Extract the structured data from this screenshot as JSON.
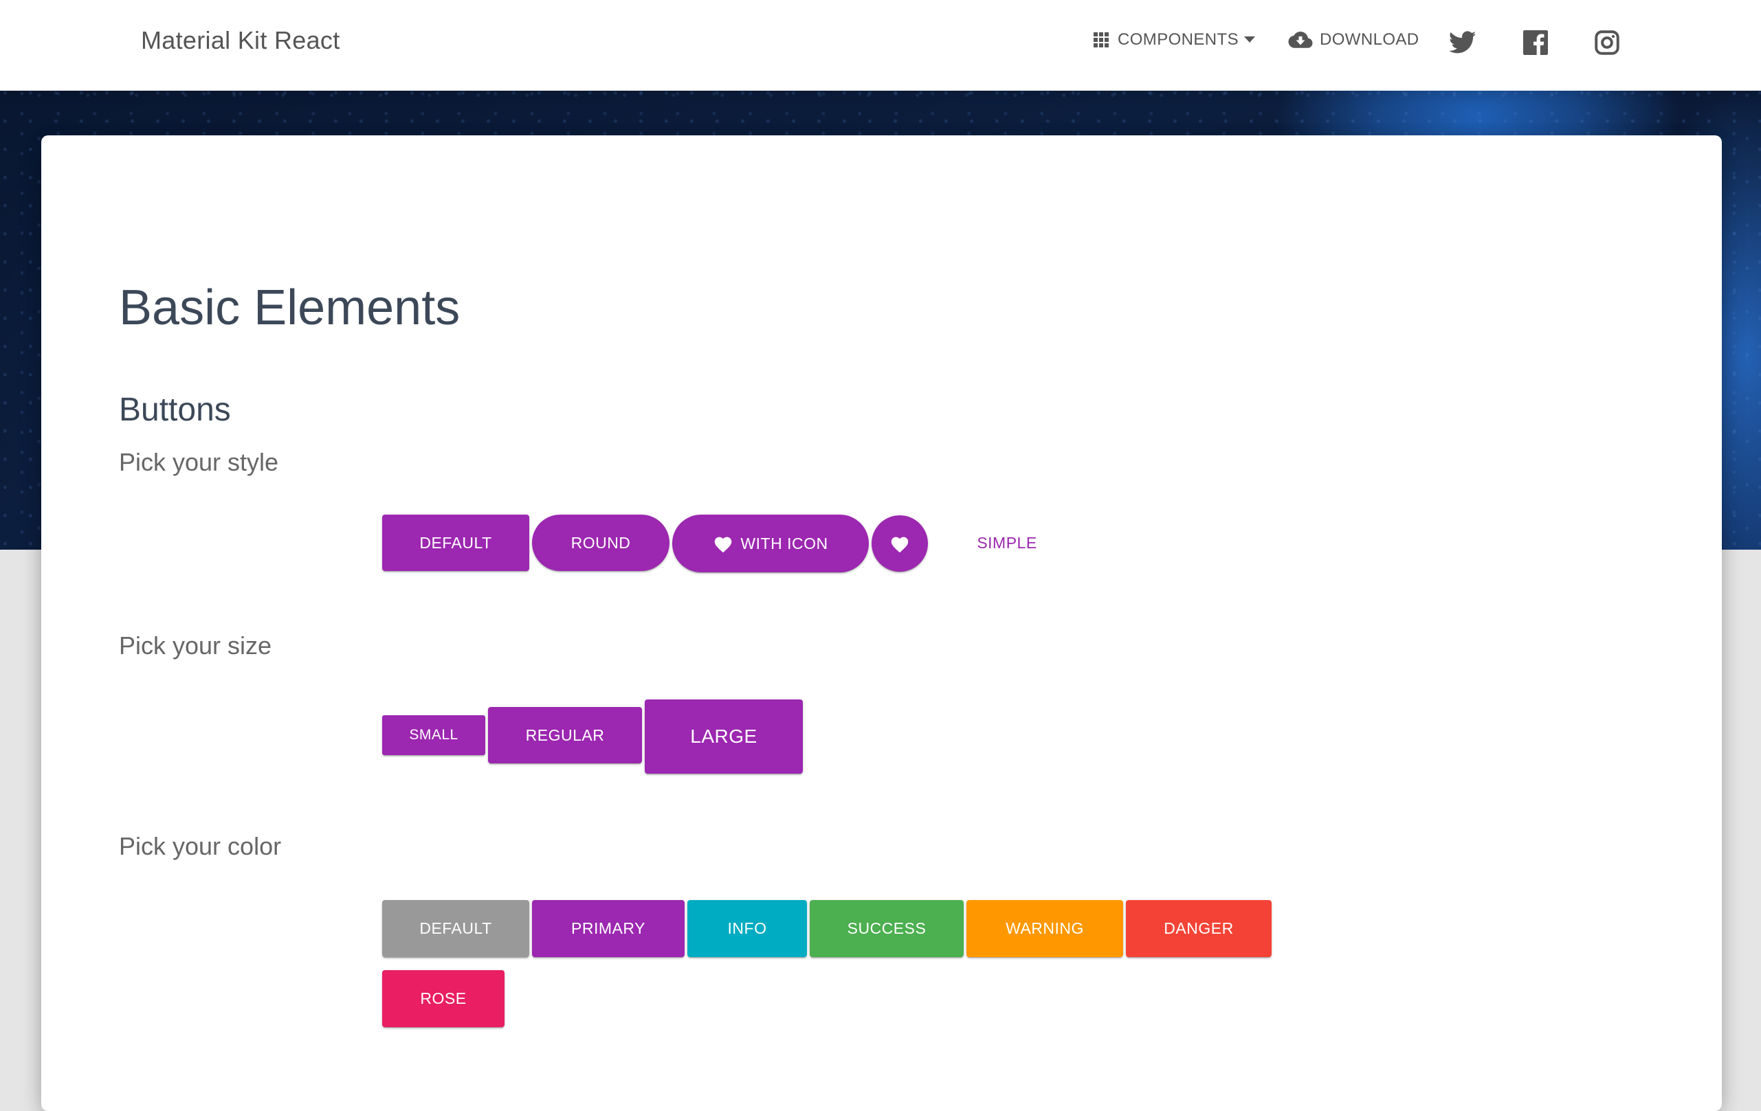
{
  "header": {
    "brand": "Material Kit React",
    "nav": {
      "components_label": "COMPONENTS",
      "download_label": "DOWNLOAD"
    },
    "icons": [
      "apps-icon",
      "caret-down-icon",
      "cloud-download-icon",
      "twitter-icon",
      "facebook-icon",
      "instagram-icon"
    ]
  },
  "main": {
    "title": "Basic Elements",
    "section": "Buttons",
    "style": {
      "heading": "Pick your style",
      "default_label": "DEFAULT",
      "round_label": "ROUND",
      "with_icon_label": "WITH ICON",
      "simple_label": "SIMPLE"
    },
    "size": {
      "heading": "Pick your size",
      "small_label": "SMALL",
      "regular_label": "REGULAR",
      "large_label": "LARGE"
    },
    "color": {
      "heading": "Pick your color",
      "buttons": [
        {
          "label": "DEFAULT",
          "color": "#999999"
        },
        {
          "label": "PRIMARY",
          "color": "#9c27b0"
        },
        {
          "label": "INFO",
          "color": "#00acc1"
        },
        {
          "label": "SUCCESS",
          "color": "#4caf50"
        },
        {
          "label": "WARNING",
          "color": "#ff9800"
        },
        {
          "label": "DANGER",
          "color": "#f44336"
        },
        {
          "label": "ROSE",
          "color": "#e91e63"
        }
      ]
    }
  },
  "colors": {
    "primary": "#9c27b0",
    "text_dark": "#3c4858",
    "text_muted": "#666666"
  }
}
